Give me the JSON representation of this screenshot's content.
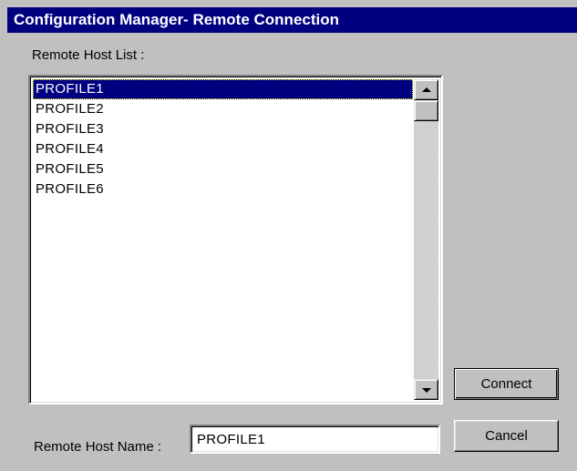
{
  "window": {
    "title": "Configuration Manager- Remote Connection"
  },
  "remote_host_list": {
    "label": "Remote Host List :",
    "items": [
      "PROFILE1",
      "PROFILE2",
      "PROFILE3",
      "PROFILE4",
      "PROFILE5",
      "PROFILE6"
    ],
    "selected": "PROFILE1"
  },
  "remote_host_name": {
    "label": "Remote Host Name :",
    "value": "PROFILE1"
  },
  "buttons": {
    "connect_label": "Connect",
    "cancel_label": "Cancel"
  },
  "icons": {
    "scroll_up": "arrow-up-icon",
    "scroll_down": "arrow-down-icon"
  },
  "colors": {
    "titlebar_bg": "#000080",
    "titlebar_text": "#ffffff",
    "selection_bg": "#000080",
    "window_bg": "#c0c0c0"
  }
}
